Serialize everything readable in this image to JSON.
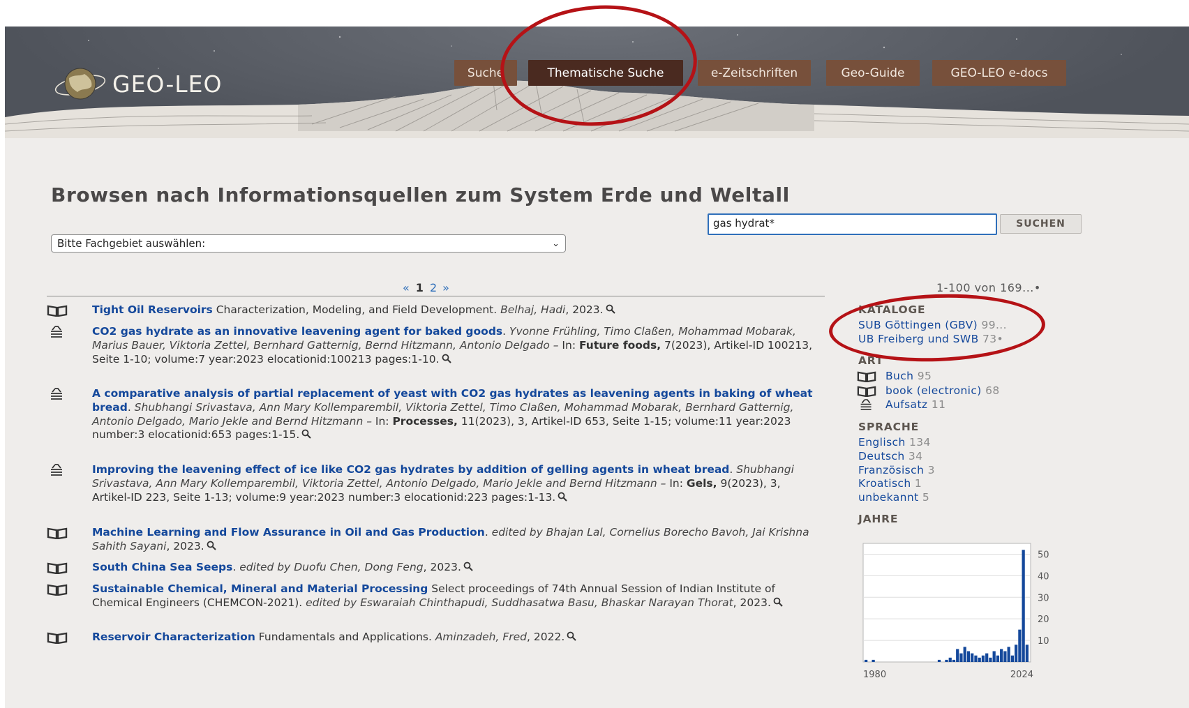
{
  "header": {
    "logo_text": "GEO-LEO",
    "nav": [
      {
        "label": "Suche",
        "active": false
      },
      {
        "label": "Thematische Suche",
        "active": true
      },
      {
        "label": "e-Zeitschriften",
        "active": false
      },
      {
        "label": "Geo-Guide",
        "active": false
      },
      {
        "label": "GEO-LEO e-docs",
        "active": false
      }
    ]
  },
  "page": {
    "title": "Browsen nach Informationsquellen zum System Erde und Weltall",
    "select_value": "Bitte Fachgebiet auswählen:",
    "search_value": "gas hydrat*",
    "search_button": "SUCHEN"
  },
  "pager": {
    "prev": "«",
    "current": "1",
    "next_page": "2",
    "next": "»",
    "count": "1-100 von 169...•"
  },
  "results": [
    {
      "icon": "book-icon",
      "title": "Tight Oil Reservoirs",
      "rest": " Characterization, Modeling, and Field Development. ",
      "authors": "Belhaj, Hadi",
      "tail": ", 2023."
    },
    {
      "icon": "article-icon",
      "title": "CO2 gas hydrate as an innovative leavening agent for baked goods",
      "rest": ". ",
      "authors": "Yvonne Frühling, Timo Claßen, Mohammad Mobarak, Marius Bauer, Viktoria Zettel, Bernhard Gatternig, Bernd Hitzmann, Antonio Delgado –",
      "pre_journal": " In: ",
      "journal": "Future foods,",
      "tail": " 7(2023), Artikel-ID 100213, Seite 1-10; volume:7 year:2023 elocationid:100213 pages:1-10."
    },
    {
      "icon": "article-icon",
      "title": "A comparative analysis of partial replacement of yeast with CO2 gas hydrates as leavening agents in baking of wheat bread",
      "rest": ". ",
      "authors": "Shubhangi Srivastava, Ann Mary Kollemparembil, Viktoria Zettel, Timo Claßen, Mohammad Mobarak, Bernhard Gatternig, Antonio Delgado, Mario Jekle and Bernd Hitzmann –",
      "pre_journal": " In: ",
      "journal": "Processes,",
      "tail": " 11(2023), 3, Artikel-ID 653, Seite 1-15; volume:11 year:2023 number:3 elocationid:653 pages:1-15."
    },
    {
      "icon": "article-icon",
      "title": "Improving the leavening effect of ice like CO2 gas hydrates by addition of gelling agents in wheat bread",
      "rest": ". ",
      "authors": "Shubhangi Srivastava, Ann Mary Kollemparembil, Viktoria Zettel, Antonio Delgado, Mario Jekle and Bernd Hitzmann –",
      "pre_journal": " In: ",
      "journal": "Gels,",
      "tail": " 9(2023), 3, Artikel-ID 223, Seite 1-13; volume:9 year:2023 number:3 elocationid:223 pages:1-13."
    },
    {
      "icon": "book-icon",
      "title": "Machine Learning and Flow Assurance in Oil and Gas Production",
      "rest": ". ",
      "authors": "edited by Bhajan Lal, Cornelius Borecho Bavoh, Jai Krishna Sahith Sayani",
      "tail": ", 2023."
    },
    {
      "icon": "book-icon",
      "title": "South China Sea Seeps",
      "rest": ". ",
      "authors": "edited by Duofu Chen, Dong Feng",
      "tail": ", 2023."
    },
    {
      "icon": "book-icon",
      "title": "Sustainable Chemical, Mineral and Material Processing",
      "rest": " Select proceedings of 74th Annual Session of Indian Institute of Chemical Engineers (CHEMCON-2021). ",
      "authors": "edited by Eswaraiah Chinthapudi, Suddhasatwa Basu, Bhaskar Narayan Thorat",
      "tail": ", 2023."
    },
    {
      "icon": "book-icon",
      "title": "Reservoir Characterization",
      "rest": " Fundamentals and Applications. ",
      "authors": "Aminzadeh, Fred",
      "tail": ", 2022."
    }
  ],
  "sidebar": {
    "kataloge": {
      "heading": "KATALOGE",
      "items": [
        {
          "label": "SUB Göttingen (GBV)",
          "count": "99..."
        },
        {
          "label": "UB Freiberg und SWB",
          "count": "73•"
        }
      ]
    },
    "art": {
      "heading": "ART",
      "items": [
        {
          "icon": "book-icon",
          "label": "Buch",
          "count": "95"
        },
        {
          "icon": "book-icon",
          "label": "book (electronic)",
          "count": "68"
        },
        {
          "icon": "article-icon",
          "label": "Aufsatz",
          "count": "11"
        }
      ]
    },
    "sprache": {
      "heading": "SPRACHE",
      "items": [
        {
          "label": "Englisch",
          "count": "134"
        },
        {
          "label": "Deutsch",
          "count": "34"
        },
        {
          "label": "Französisch",
          "count": "3"
        },
        {
          "label": "Kroatisch",
          "count": "1"
        },
        {
          "label": "unbekannt",
          "count": "5"
        }
      ]
    },
    "jahre": {
      "heading": "JAHRE"
    }
  },
  "colors": {
    "accent": "#14489b",
    "nav": "#77503b",
    "nav_active": "#4a2a20",
    "annotation": "#b51216",
    "bar": "#14489b"
  },
  "chart_data": {
    "type": "bar",
    "x_start": 1980,
    "x_end": 2024,
    "xtick_labels": [
      "1980",
      "2024"
    ],
    "ytick_labels": [
      "10",
      "20",
      "30",
      "40",
      "50"
    ],
    "ylim": [
      0,
      55
    ],
    "grid": true,
    "values": [
      1,
      0,
      1,
      0,
      0,
      0,
      0,
      0,
      0,
      0,
      0,
      0,
      0,
      0,
      0,
      0,
      0,
      0,
      0,
      0,
      1,
      0,
      1,
      2,
      1,
      6,
      4,
      7,
      5,
      4,
      3,
      2,
      3,
      4,
      2,
      5,
      3,
      6,
      5,
      7,
      3,
      8,
      15,
      52,
      8
    ]
  }
}
